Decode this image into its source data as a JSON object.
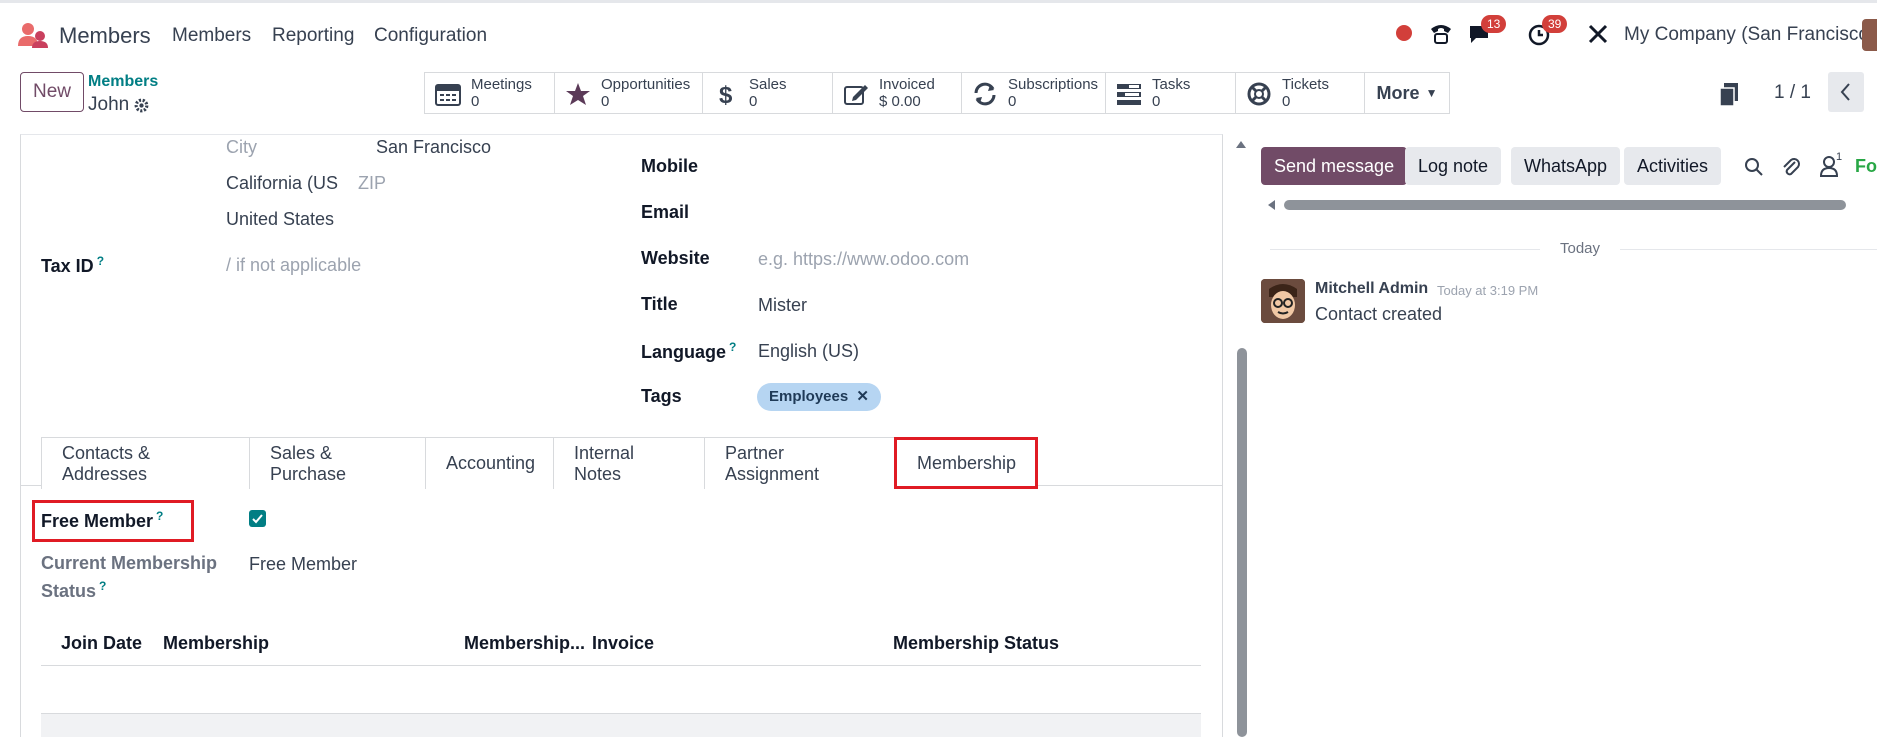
{
  "topbar": {
    "app_name": "Members",
    "menu": [
      "Members",
      "Reporting",
      "Configuration"
    ],
    "badges": {
      "messages": "13",
      "activities": "39"
    },
    "company": "My Company (San Francisco)"
  },
  "control": {
    "new_label": "New",
    "breadcrumb_parent": "Members",
    "breadcrumb_current": "John",
    "smart_buttons": [
      {
        "label": "Meetings",
        "value": "0",
        "icon": "calendar-icon"
      },
      {
        "label": "Opportunities",
        "value": "0",
        "icon": "star-icon"
      },
      {
        "label": "Sales",
        "value": "0",
        "icon": "dollar-icon"
      },
      {
        "label": "Invoiced",
        "value": "$ 0.00",
        "icon": "pencil-square-icon"
      },
      {
        "label": "Subscriptions",
        "value": "0",
        "icon": "refresh-icon"
      },
      {
        "label": "Tasks",
        "value": "0",
        "icon": "tasks-icon"
      },
      {
        "label": "Tickets",
        "value": "0",
        "icon": "life-ring-icon"
      }
    ],
    "more_label": "More",
    "pager": "1 / 1"
  },
  "form": {
    "city_placeholder": "City",
    "city_value": "San Francisco",
    "state": "California (US",
    "zip_placeholder": "ZIP",
    "country": "United States",
    "tax_id_label": "Tax ID",
    "tax_id_placeholder": "/ if not applicable",
    "mobile_label": "Mobile",
    "email_label": "Email",
    "website_label": "Website",
    "website_placeholder": "e.g. https://www.odoo.com",
    "title_label": "Title",
    "title_value": "Mister",
    "language_label": "Language",
    "language_value": "English (US)",
    "tags_label": "Tags",
    "tag": "Employees",
    "q_mark": "?",
    "tabs": [
      "Contacts & Addresses",
      "Sales & Purchase",
      "Accounting",
      "Internal Notes",
      "Partner Assignment",
      "Membership"
    ],
    "free_member_label": "Free Member",
    "free_member_checked": true,
    "status_label_1": "Current Membership",
    "status_label_2": "Status",
    "status_value": "Free Member",
    "table_headers": [
      "Join Date",
      "Membership",
      "Membership...",
      "Invoice",
      "Membership Status"
    ]
  },
  "chatter": {
    "send_message": "Send message",
    "log_note": "Log note",
    "whatsapp": "WhatsApp",
    "activities": "Activities",
    "followers_count": "1",
    "follow_label": "Fol",
    "today": "Today",
    "author": "Mitchell Admin",
    "time": "Today at 3:19 PM",
    "message": "Contact created"
  }
}
